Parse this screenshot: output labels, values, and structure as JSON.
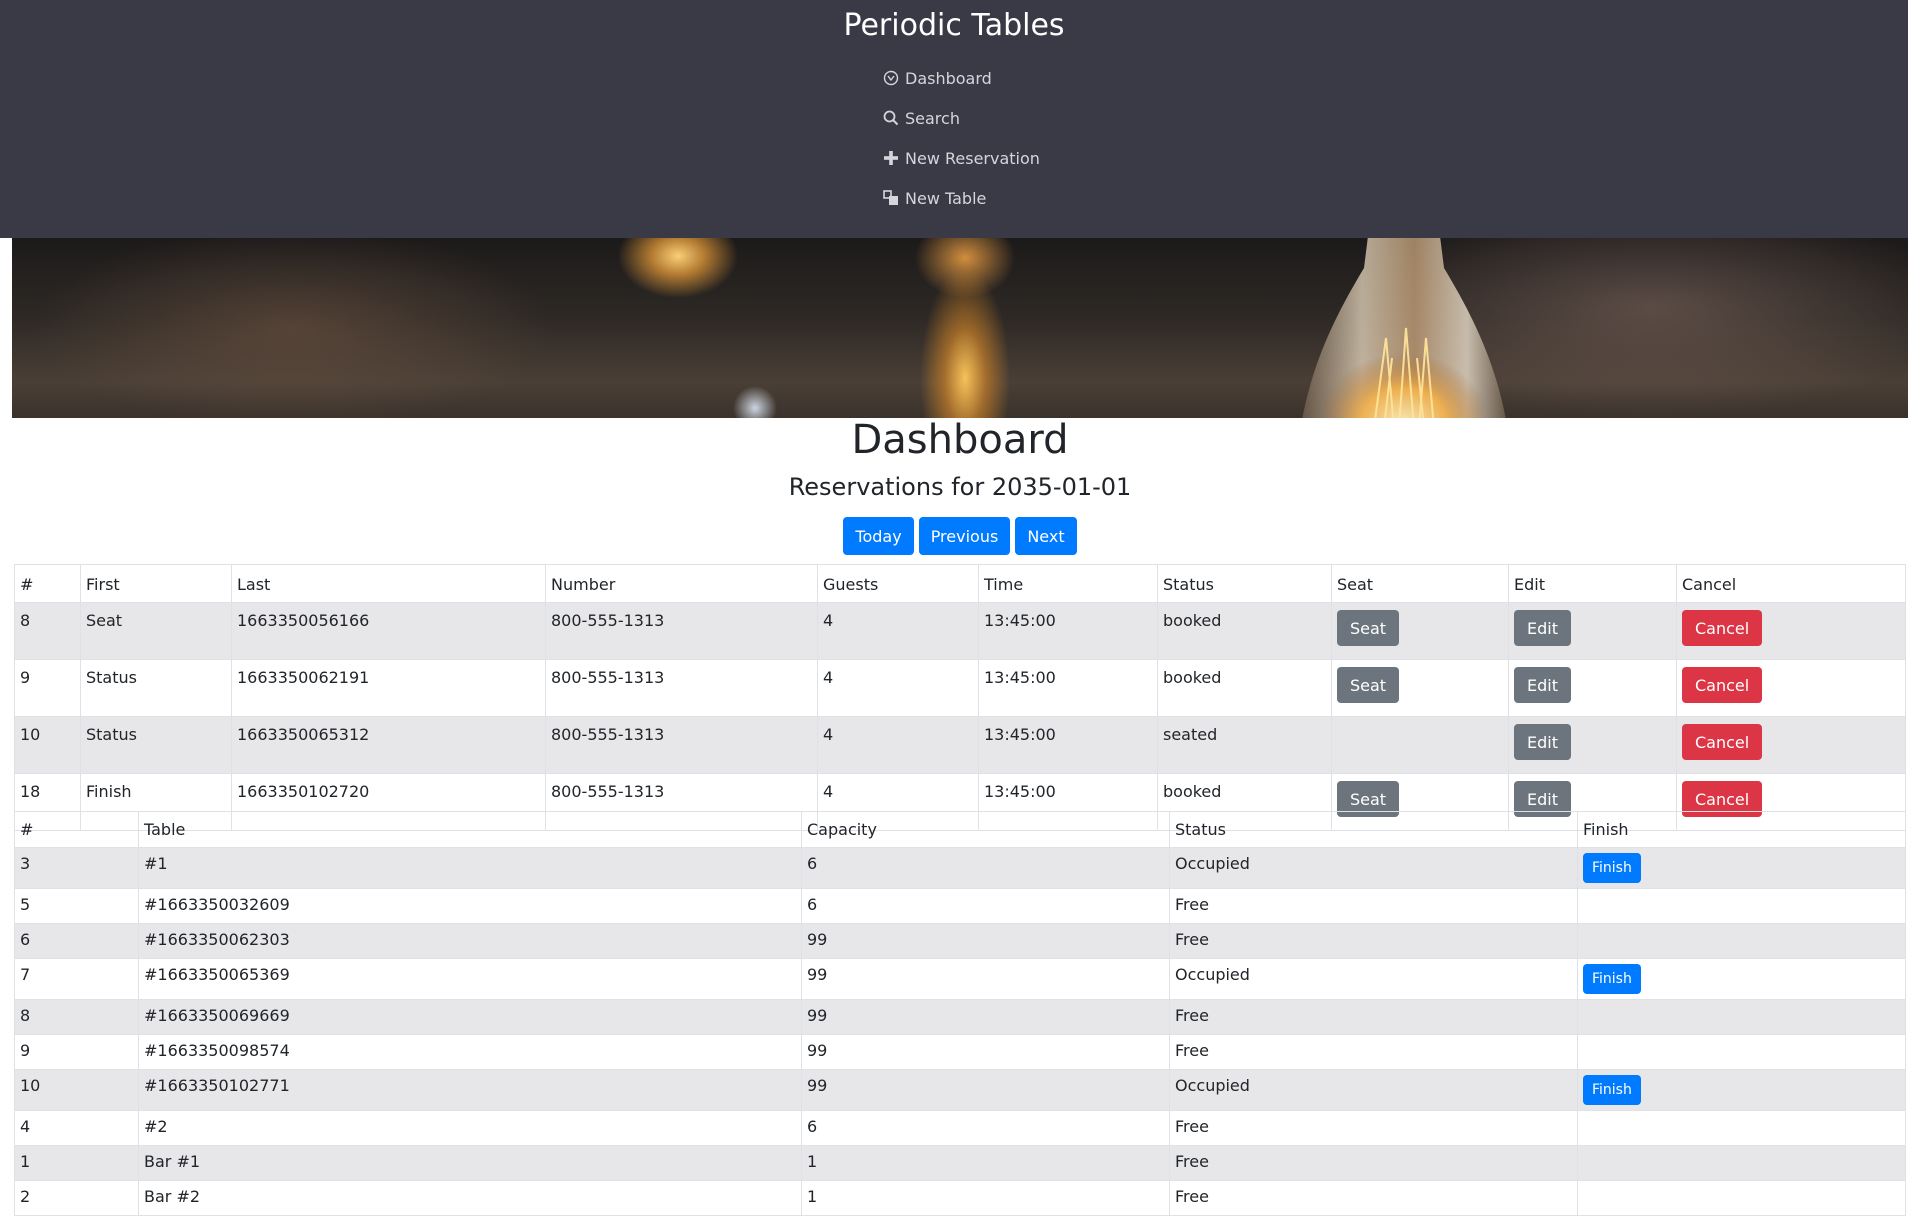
{
  "app": {
    "title": "Periodic Tables"
  },
  "nav": {
    "items": [
      {
        "label": "Dashboard",
        "icon": "dashboard-icon"
      },
      {
        "label": "Search",
        "icon": "search-icon"
      },
      {
        "label": "New Reservation",
        "icon": "plus-icon"
      },
      {
        "label": "New Table",
        "icon": "new-table-icon"
      }
    ]
  },
  "main": {
    "title": "Dashboard",
    "subtitle": "Reservations for 2035-01-01",
    "buttons": {
      "today": "Today",
      "previous": "Previous",
      "next": "Next"
    }
  },
  "reservations": {
    "headers": [
      "#",
      "First",
      "Last",
      "Number",
      "Guests",
      "Time",
      "Status",
      "Seat",
      "Edit",
      "Cancel"
    ],
    "rows": [
      {
        "id": "8",
        "first": "Seat",
        "last": "1663350056166",
        "number": "800-555-1313",
        "guests": "4",
        "time": "13:45:00",
        "status": "booked",
        "seat": "Seat",
        "edit": "Edit",
        "cancel": "Cancel"
      },
      {
        "id": "9",
        "first": "Status",
        "last": "1663350062191",
        "number": "800-555-1313",
        "guests": "4",
        "time": "13:45:00",
        "status": "booked",
        "seat": "Seat",
        "edit": "Edit",
        "cancel": "Cancel"
      },
      {
        "id": "10",
        "first": "Status",
        "last": "1663350065312",
        "number": "800-555-1313",
        "guests": "4",
        "time": "13:45:00",
        "status": "seated",
        "seat": "",
        "edit": "Edit",
        "cancel": "Cancel"
      },
      {
        "id": "18",
        "first": "Finish",
        "last": "1663350102720",
        "number": "800-555-1313",
        "guests": "4",
        "time": "13:45:00",
        "status": "booked",
        "seat": "Seat",
        "edit": "Edit",
        "cancel": "Cancel"
      }
    ]
  },
  "tables": {
    "headers": [
      "#",
      "Table",
      "Capacity",
      "Status",
      "Finish"
    ],
    "rows": [
      {
        "id": "3",
        "name": "#1",
        "capacity": "6",
        "status": "Occupied",
        "finish": "Finish"
      },
      {
        "id": "5",
        "name": "#1663350032609",
        "capacity": "6",
        "status": "Free",
        "finish": ""
      },
      {
        "id": "6",
        "name": "#1663350062303",
        "capacity": "99",
        "status": "Free",
        "finish": ""
      },
      {
        "id": "7",
        "name": "#1663350065369",
        "capacity": "99",
        "status": "Occupied",
        "finish": "Finish"
      },
      {
        "id": "8",
        "name": "#1663350069669",
        "capacity": "99",
        "status": "Free",
        "finish": ""
      },
      {
        "id": "9",
        "name": "#1663350098574",
        "capacity": "99",
        "status": "Free",
        "finish": ""
      },
      {
        "id": "10",
        "name": "#1663350102771",
        "capacity": "99",
        "status": "Occupied",
        "finish": "Finish"
      },
      {
        "id": "4",
        "name": "#2",
        "capacity": "6",
        "status": "Free",
        "finish": ""
      },
      {
        "id": "1",
        "name": "Bar #1",
        "capacity": "1",
        "status": "Free",
        "finish": ""
      },
      {
        "id": "2",
        "name": "Bar #2",
        "capacity": "1",
        "status": "Free",
        "finish": ""
      }
    ]
  },
  "colors": {
    "header_bg": "#393a45",
    "primary": "#007bff",
    "secondary": "#6c757d",
    "danger": "#dc3545",
    "stripe": "#e7e7ea"
  }
}
